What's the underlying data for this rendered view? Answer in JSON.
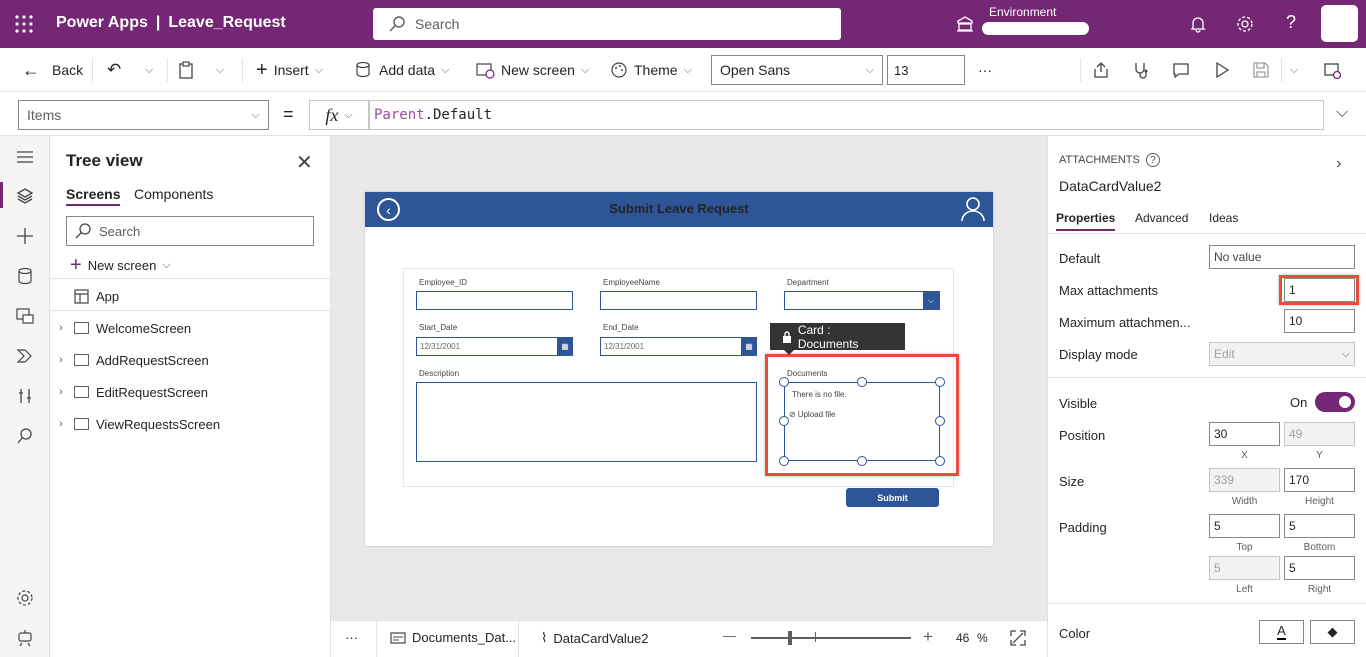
{
  "header": {
    "app_name": "Power Apps",
    "separator": "|",
    "project_name": "Leave_Request",
    "search_placeholder": "Search",
    "environment_label": "Environment"
  },
  "toolbar": {
    "back": "Back",
    "insert": "Insert",
    "add_data": "Add data",
    "new_screen": "New screen",
    "theme": "Theme",
    "font": "Open Sans",
    "font_size": "13",
    "more": "···"
  },
  "formula_bar": {
    "property": "Items",
    "equals": "=",
    "fx": "fx",
    "formula_part1": "Parent",
    "formula_part2": ".Default"
  },
  "tree": {
    "title": "Tree view",
    "tabs": [
      "Screens",
      "Components"
    ],
    "search_placeholder": "Search",
    "new_screen": "New screen",
    "items": [
      {
        "label": "App"
      },
      {
        "label": "WelcomeScreen"
      },
      {
        "label": "AddRequestScreen"
      },
      {
        "label": "EditRequestScreen"
      },
      {
        "label": "ViewRequestsScreen"
      }
    ]
  },
  "app_screen": {
    "title": "Submit Leave Request",
    "fields": {
      "employee_id": "Employee_ID",
      "employee_name": "EmployeeName",
      "department": "Department",
      "start_date": "Start_Date",
      "start_date_value": "12/31/2001",
      "end_date": "End_Date",
      "end_date_value": "12/31/2001",
      "description": "Description",
      "documents": "Documents",
      "no_file": "There is no file.",
      "upload": "Upload file"
    },
    "submit": "Submit",
    "card_tooltip": "Card : Documents"
  },
  "status": {
    "more": "···",
    "crumb1": "Documents_Dat...",
    "crumb2": "DataCardValue2",
    "minus": "—",
    "plus": "+",
    "zoom": "46",
    "percent": "%"
  },
  "panel": {
    "type": "ATTACHMENTS",
    "name": "DataCardValue2",
    "tabs": [
      "Properties",
      "Advanced",
      "Ideas"
    ],
    "default_label": "Default",
    "default_value": "No value",
    "max_attach_label": "Max attachments",
    "max_attach_value": "1",
    "max_size_label": "Maximum attachmen...",
    "max_size_value": "10",
    "display_mode_label": "Display mode",
    "display_mode_value": "Edit",
    "visible_label": "Visible",
    "visible_value": "On",
    "position_label": "Position",
    "pos_x": "30",
    "pos_y": "49",
    "x_cap": "X",
    "y_cap": "Y",
    "size_label": "Size",
    "width": "339",
    "height": "170",
    "width_cap": "Width",
    "height_cap": "Height",
    "padding_label": "Padding",
    "pad_top": "5",
    "pad_bottom": "5",
    "pad_left": "5",
    "pad_right": "5",
    "top_cap": "Top",
    "bottom_cap": "Bottom",
    "left_cap": "Left",
    "right_cap": "Right",
    "color_label": "Color",
    "color_text_glyph": "A"
  },
  "colors": {
    "brand": "#742774",
    "app_header": "#2e5597",
    "highlight": "#e74c3c"
  }
}
